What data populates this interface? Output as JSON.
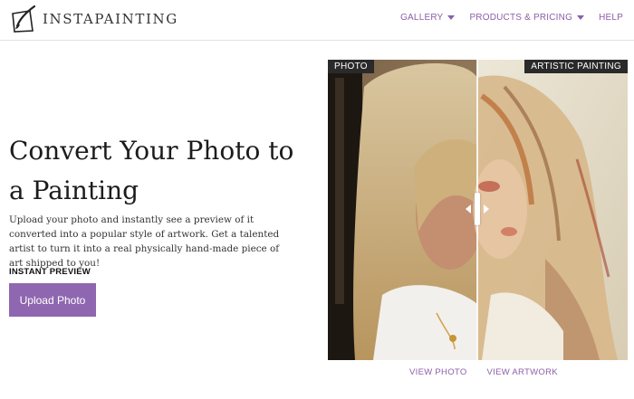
{
  "brand": {
    "name": "INSTAPAINTING",
    "logo_icon": "paintbrush-canvas-icon",
    "accent": "#8c5fa8"
  },
  "nav": {
    "items": [
      {
        "label": "GALLERY",
        "has_dropdown": true
      },
      {
        "label": "PRODUCTS & PRICING",
        "has_dropdown": true
      },
      {
        "label": "HELP",
        "has_dropdown": false
      }
    ]
  },
  "hero": {
    "title": "Convert Your Photo to a Painting",
    "description": "Upload your photo and instantly see a preview of it converted into a popular style of artwork. Get a talented artist to turn it into a real physically hand-made piece of art shipped to you!",
    "instant_label": "INSTANT PREVIEW",
    "upload_label": "Upload Photo",
    "button_color": "#8f67b0"
  },
  "compare": {
    "left_tag": "PHOTO",
    "right_tag": "ARTISTIC PAINTING",
    "slider_position": 0.5,
    "view_photo": "VIEW PHOTO",
    "view_artwork": "VIEW ARTWORK"
  }
}
